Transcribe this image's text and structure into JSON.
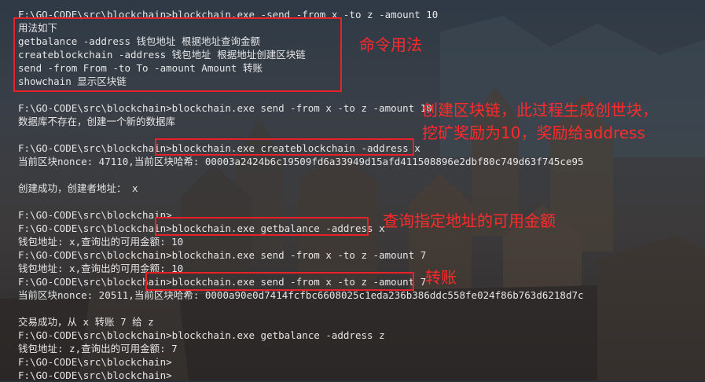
{
  "terminal": {
    "lines": [
      "F:\\GO-CODE\\src\\blockchain>blockchain.exe -send -from x -to z -amount 10",
      "用法如下",
      "getbalance -address 钱包地址 根据地址查询金额",
      "createblockchain -address 钱包地址 根据地址创建区块链",
      "send -from From -to To -amount Amount 转账",
      "showchain 显示区块链",
      "",
      "F:\\GO-CODE\\src\\blockchain>blockchain.exe send -from x -to z -amount 10",
      "数据库不存在，创建一个新的数据库",
      "",
      "F:\\GO-CODE\\src\\blockchain>blockchain.exe createblockchain -address x",
      "当前区块nonce: 47110,当前区块哈希: 00003a2424b6c19509fd6a33949d15afd411508896e2dbf80c749d63f745ce95",
      "",
      "创建成功，创建者地址： x",
      "",
      "F:\\GO-CODE\\src\\blockchain>",
      "F:\\GO-CODE\\src\\blockchain>blockchain.exe getbalance -address x",
      "钱包地址: x,查询出的可用金额: 10",
      "F:\\GO-CODE\\src\\blockchain>blockchain.exe send -from x -to z -amount 7",
      "钱包地址: x,查询出的可用金额: 10",
      "F:\\GO-CODE\\src\\blockchain>blockchain.exe send -from x -to z -amount 7",
      "当前区块nonce: 20511,当前区块哈希: 0000a90e0d7414fcfbc6608025c1eda236b386ddc558fe024f86b763d6218d7c",
      "",
      "交易成功，从 x 转账 7 给 z",
      "F:\\GO-CODE\\src\\blockchain>blockchain.exe getbalance -address z",
      "钱包地址: z,查询出的可用金额: 7",
      "F:\\GO-CODE\\src\\blockchain>",
      "F:\\GO-CODE\\src\\blockchain>"
    ]
  },
  "annotations": {
    "usage": "命令用法",
    "create_line1": "创建区块链，此过程生成创世块，",
    "create_line2": "挖矿奖励为10，奖励给address",
    "balance": "查询指定地址的可用金额",
    "transfer": "转账"
  },
  "colors": {
    "annotation": "#ff2a2a",
    "highlight_border": "#e8202a",
    "terminal_text": "#e6e6e6"
  }
}
